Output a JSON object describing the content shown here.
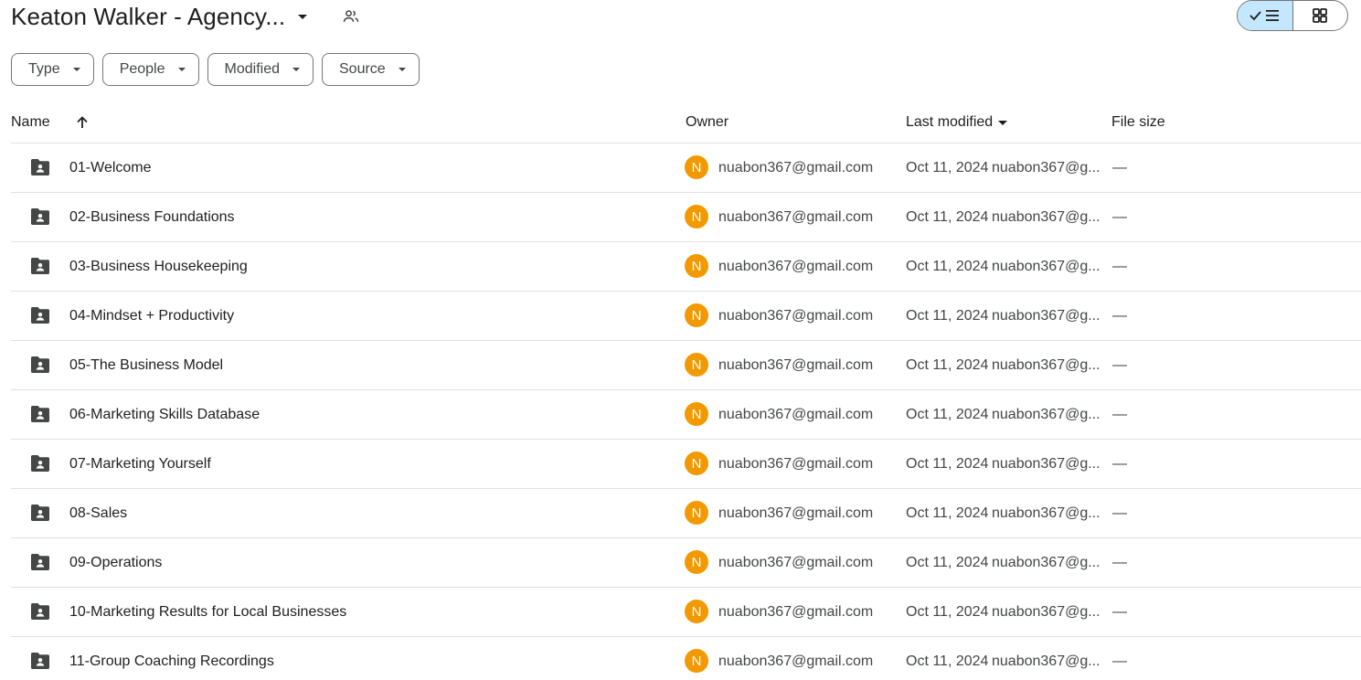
{
  "header": {
    "title": "Keaton Walker - Agency...",
    "shared_icon": "shared-folder-people-icon",
    "view_toggle": {
      "list_icon": "check-list-icon",
      "grid_icon": "grid-icon",
      "selected": "list"
    }
  },
  "filters": [
    {
      "label": "Type"
    },
    {
      "label": "People"
    },
    {
      "label": "Modified"
    },
    {
      "label": "Source"
    }
  ],
  "table": {
    "columns": {
      "name": "Name",
      "owner": "Owner",
      "last_modified": "Last modified",
      "file_size": "File size"
    },
    "sort_icon": "arrow-up-icon",
    "rows": [
      {
        "name": "01-Welcome",
        "avatar": "N",
        "owner": "nuabon367@gmail.com",
        "date": "Oct 11, 2024",
        "modified_by": "nuabon367@g...",
        "size": "—"
      },
      {
        "name": "02-Business Foundations",
        "avatar": "N",
        "owner": "nuabon367@gmail.com",
        "date": "Oct 11, 2024",
        "modified_by": "nuabon367@g...",
        "size": "—"
      },
      {
        "name": "03-Business Housekeeping",
        "avatar": "N",
        "owner": "nuabon367@gmail.com",
        "date": "Oct 11, 2024",
        "modified_by": "nuabon367@g...",
        "size": "—"
      },
      {
        "name": "04-Mindset + Productivity",
        "avatar": "N",
        "owner": "nuabon367@gmail.com",
        "date": "Oct 11, 2024",
        "modified_by": "nuabon367@g...",
        "size": "—"
      },
      {
        "name": "05-The Business Model",
        "avatar": "N",
        "owner": "nuabon367@gmail.com",
        "date": "Oct 11, 2024",
        "modified_by": "nuabon367@g...",
        "size": "—"
      },
      {
        "name": "06-Marketing Skills Database",
        "avatar": "N",
        "owner": "nuabon367@gmail.com",
        "date": "Oct 11, 2024",
        "modified_by": "nuabon367@g...",
        "size": "—"
      },
      {
        "name": "07-Marketing Yourself",
        "avatar": "N",
        "owner": "nuabon367@gmail.com",
        "date": "Oct 11, 2024",
        "modified_by": "nuabon367@g...",
        "size": "—"
      },
      {
        "name": "08-Sales",
        "avatar": "N",
        "owner": "nuabon367@gmail.com",
        "date": "Oct 11, 2024",
        "modified_by": "nuabon367@g...",
        "size": "—"
      },
      {
        "name": "09-Operations",
        "avatar": "N",
        "owner": "nuabon367@gmail.com",
        "date": "Oct 11, 2024",
        "modified_by": "nuabon367@g...",
        "size": "—"
      },
      {
        "name": "10-Marketing Results for Local Businesses",
        "avatar": "N",
        "owner": "nuabon367@gmail.com",
        "date": "Oct 11, 2024",
        "modified_by": "nuabon367@g...",
        "size": "—"
      },
      {
        "name": "11-Group Coaching Recordings",
        "avatar": "N",
        "owner": "nuabon367@gmail.com",
        "date": "Oct 11, 2024",
        "modified_by": "nuabon367@g...",
        "size": "—"
      }
    ]
  },
  "colors": {
    "avatar_bg": "#f29900",
    "toggle_selected_bg": "#c2e7ff",
    "divider": "#e0e0e0"
  }
}
